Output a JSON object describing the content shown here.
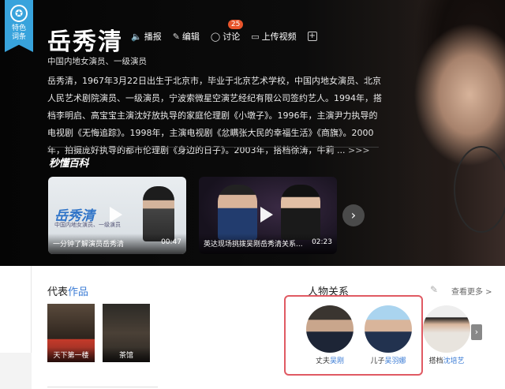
{
  "badge": {
    "icon": "special-entry-icon",
    "text": "特色词条"
  },
  "person": {
    "name": "岳秀清",
    "subtitle": "中国内地女演员、一级演员"
  },
  "actions": {
    "report": "播报",
    "edit": "编辑",
    "discuss": "讨论",
    "discuss_count": "25",
    "upload_video": "上传视频",
    "add": "+"
  },
  "summary": {
    "text": "岳秀清，1967年3月22日出生于北京市，毕业于北京艺术学校，中国内地女演员、北京人民艺术剧院演员、一级演员，宁波索微星空演艺经纪有限公司签约艺人。1994年，搭档李明启、高宝宝主演沈好放执导的家庭伦理剧《小墩子》。1996年，主演尹力执导的电视剧《无悔追踪》。1998年，主演电视剧《忿瞒张大民的幸福生活》《商旗》。2000年，拍摄庞好执导的都市伦理剧《身边的日子》。2003年，搭档徐涛，牛莉 ...",
    "more": ">>>"
  },
  "brand": "秒懂百科",
  "videos": [
    {
      "overlay_title": "岳秀清",
      "overlay_sub": "中国内地女演员、一级演员",
      "caption": "一分钟了解演员岳秀清",
      "duration": "00:47"
    },
    {
      "caption": "英达现场挑拨吴刚岳秀清关系...",
      "duration": "02:23"
    }
  ],
  "works": {
    "title_a": "代表",
    "title_b": "作品",
    "items": [
      {
        "label": "天下第一楼"
      },
      {
        "label": "茶馆"
      }
    ]
  },
  "relations": {
    "title": "人物关系",
    "more": "查看更多 >",
    "people": [
      {
        "role": "丈夫",
        "name": "吴刚"
      },
      {
        "role": "儿子",
        "name": "吴羽娜"
      },
      {
        "role": "搭档",
        "name": "沈培艺"
      }
    ]
  },
  "colors": {
    "badge": "#38a3dc",
    "accent": "#3a7bd5",
    "highlight_box": "#e05a63",
    "count_bubble": "#e8542b"
  }
}
